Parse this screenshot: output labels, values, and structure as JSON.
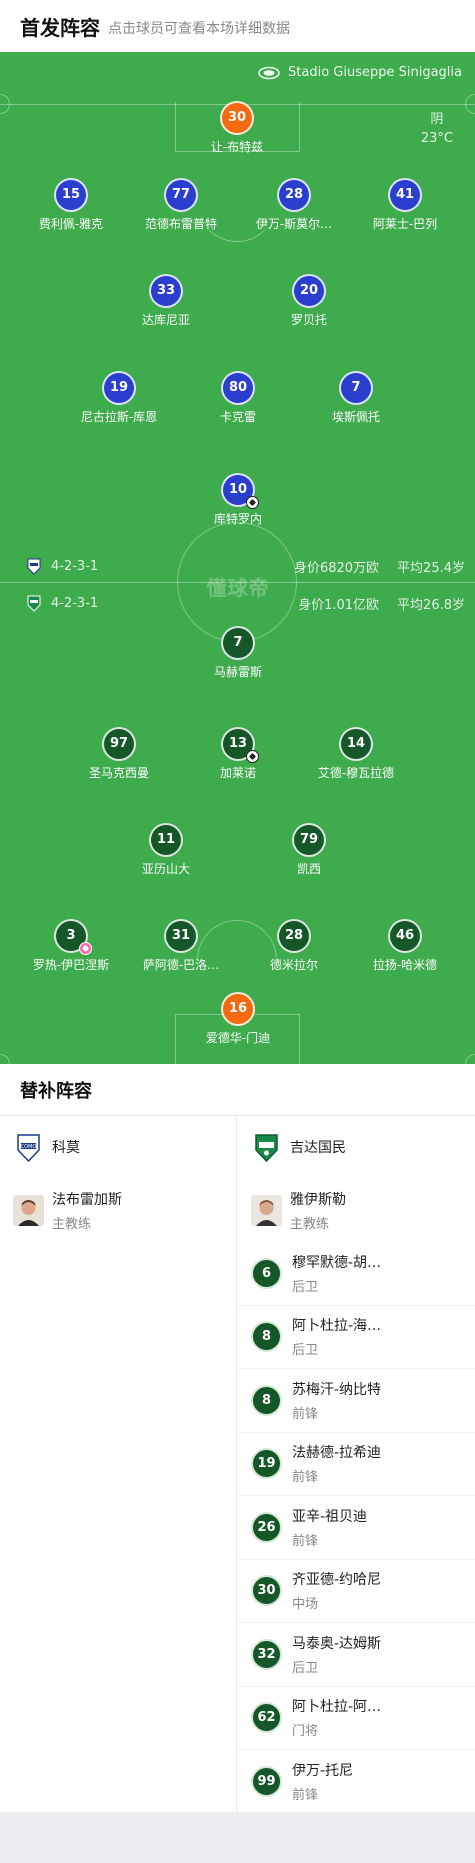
{
  "header": {
    "title": "首发阵容",
    "subtitle": "点击球员可查看本场详细数据"
  },
  "venue": {
    "stadium": "Stadio Giuseppe Sinigaglia",
    "weather": "阴",
    "temperature": "23°C"
  },
  "watermark": "懂球帝",
  "colors": {
    "pitch": "#3eab4d",
    "home_badge": "#2b3fcf",
    "away_badge": "#16572a",
    "keeper_badge": "#f36a10"
  },
  "home_team_row": {
    "formation": "4-2-3-1",
    "value": "身价6820万欧",
    "avg_age": "平均25.4岁"
  },
  "away_team_row": {
    "formation": "4-2-3-1",
    "value": "身价1.01亿欧",
    "avg_age": "平均26.8岁"
  },
  "home_players": [
    {
      "number": "30",
      "name": "让-布特兹",
      "keeper": true
    },
    {
      "number": "15",
      "name": "费利佩-雅克"
    },
    {
      "number": "77",
      "name": "范德布雷普特"
    },
    {
      "number": "28",
      "name": "伊万-斯莫尔…"
    },
    {
      "number": "41",
      "name": "阿莱士-巴列"
    },
    {
      "number": "33",
      "name": "达库尼亚"
    },
    {
      "number": "20",
      "name": "罗贝托"
    },
    {
      "number": "19",
      "name": "尼古拉斯-库恩"
    },
    {
      "number": "80",
      "name": "卡克雷"
    },
    {
      "number": "7",
      "name": "埃斯佩托"
    },
    {
      "number": "10",
      "name": "库特罗内",
      "goal": true
    }
  ],
  "away_players": [
    {
      "number": "7",
      "name": "马赫雷斯"
    },
    {
      "number": "97",
      "name": "圣马克西曼"
    },
    {
      "number": "13",
      "name": "加莱诺",
      "goal": true
    },
    {
      "number": "14",
      "name": "艾德-穆瓦拉德"
    },
    {
      "number": "11",
      "name": "亚历山大"
    },
    {
      "number": "79",
      "name": "凯西"
    },
    {
      "number": "3",
      "name": "罗热-伊巴涅斯",
      "own_goal": true
    },
    {
      "number": "31",
      "name": "萨阿德-巴洛…"
    },
    {
      "number": "28",
      "name": "德米拉尔"
    },
    {
      "number": "46",
      "name": "拉扬-哈米德"
    },
    {
      "number": "16",
      "name": "爱德华-门迪",
      "keeper": true
    }
  ],
  "subs": {
    "title": "替补阵容",
    "home": {
      "team": "科莫",
      "coach_name": "法布雷加斯",
      "coach_role": "主教练"
    },
    "away": {
      "team": "吉达国民",
      "coach_name": "雅伊斯勒",
      "coach_role": "主教练",
      "players": [
        {
          "number": "6",
          "name": "穆罕默德-胡…",
          "position": "后卫"
        },
        {
          "number": "8",
          "name": "阿卜杜拉-海…",
          "position": "后卫"
        },
        {
          "number": "8",
          "name": "苏梅汗-纳比特",
          "position": "前锋"
        },
        {
          "number": "19",
          "name": "法赫德-拉希迪",
          "position": "前锋"
        },
        {
          "number": "26",
          "name": "亚辛-祖贝迪",
          "position": "前锋"
        },
        {
          "number": "30",
          "name": "齐亚德-约哈尼",
          "position": "中场"
        },
        {
          "number": "32",
          "name": "马泰奥-达姆斯",
          "position": "后卫"
        },
        {
          "number": "62",
          "name": "阿卜杜拉-阿…",
          "position": "门将"
        },
        {
          "number": "99",
          "name": "伊万-托尼",
          "position": "前锋"
        }
      ]
    }
  }
}
